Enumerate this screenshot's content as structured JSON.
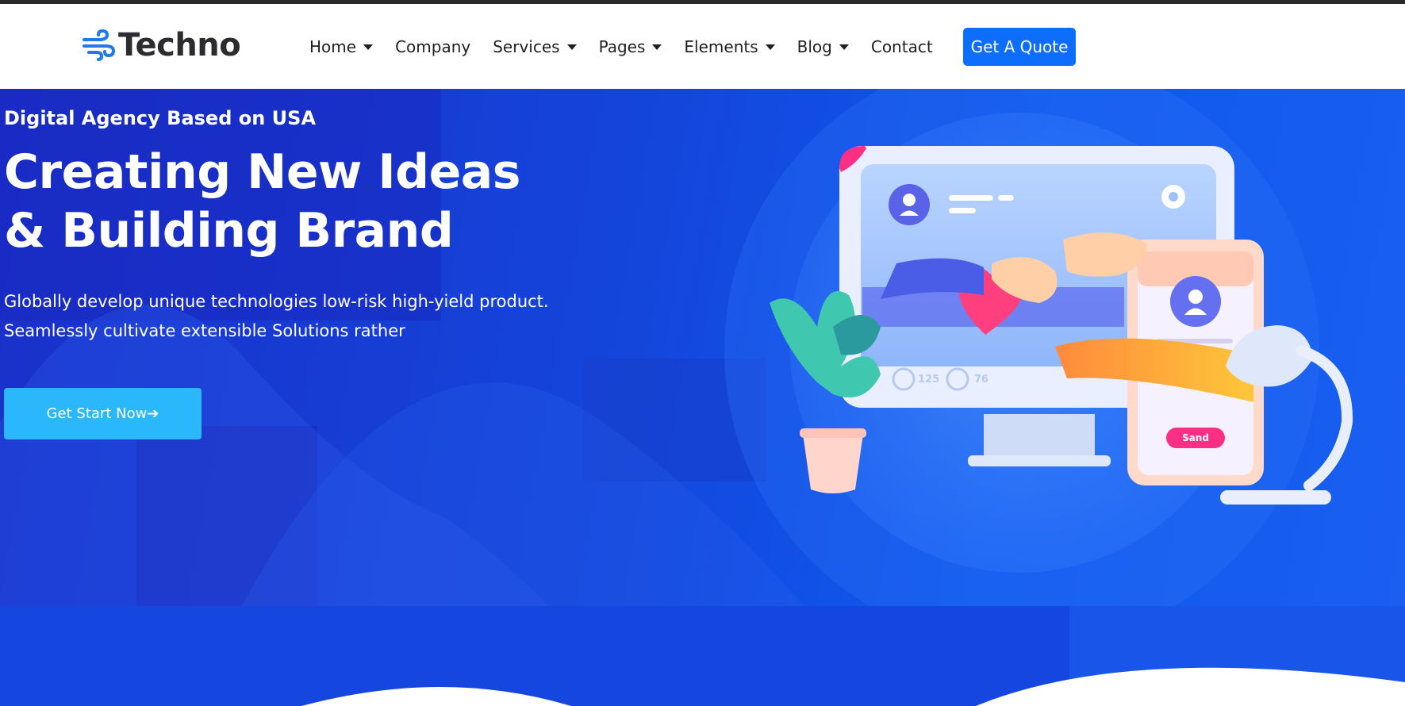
{
  "brand": {
    "name": "Techno",
    "logo_icon": "wind-icon",
    "accent": "#0d6efd"
  },
  "nav": {
    "items": [
      {
        "label": "Home",
        "dropdown": true
      },
      {
        "label": "Company",
        "dropdown": false
      },
      {
        "label": "Services",
        "dropdown": true
      },
      {
        "label": "Pages",
        "dropdown": true
      },
      {
        "label": "Elements",
        "dropdown": true
      },
      {
        "label": "Blog",
        "dropdown": true
      },
      {
        "label": "Contact",
        "dropdown": false
      }
    ],
    "cta_label": "Get A Quote"
  },
  "hero": {
    "subtitle": "Digital Agency Based on USA",
    "title_line1": "Creating New Ideas",
    "title_line2": "& Building Brand",
    "desc_line1": "Globally develop unique technologies low-risk high-yield product.",
    "desc_line2": "Seamlessly cultivate extensible Solutions rather",
    "cta_label": "Get Start Now➔",
    "cta_color": "#2bb7fb",
    "illustration": {
      "likes": "125",
      "comments": "76",
      "send_label": "Sand"
    }
  }
}
